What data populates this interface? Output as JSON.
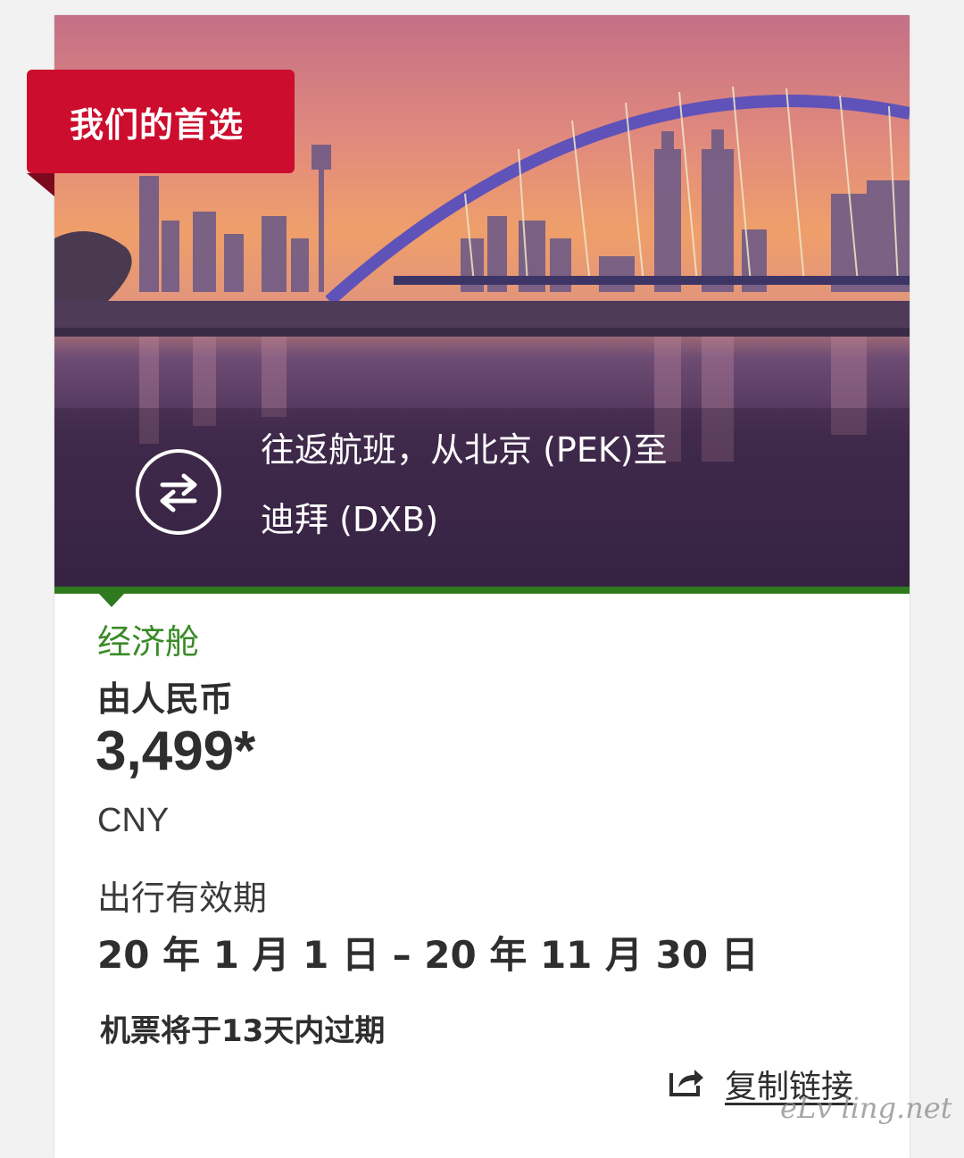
{
  "badge": {
    "label": "我们的首选"
  },
  "route": {
    "line1": "往返航班，从北京 (PEK)至",
    "line2": "迪拜 (DXB)",
    "icon": "round-trip-arrows-icon"
  },
  "fare": {
    "cabin": "经济舱",
    "from_label": "由人民币",
    "price": "3,499*",
    "currency": "CNY"
  },
  "validity": {
    "label": "出行有效期",
    "range": "20 年 1 月 1 日 – 20 年 11 月 30 日",
    "expiry_note": "机票将于13天内过期"
  },
  "share": {
    "icon": "share-icon",
    "label": "复制链接"
  },
  "watermark": "eLv ling.net",
  "colors": {
    "badge_red": "#cc0d2e",
    "accent_green": "#2f7a1f",
    "cabin_green": "#3a8a28"
  }
}
